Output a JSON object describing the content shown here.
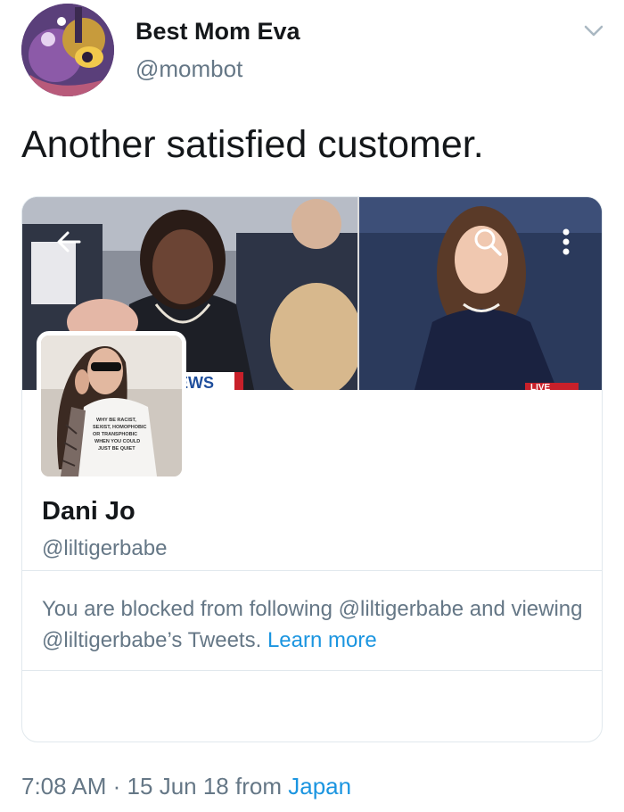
{
  "tweet": {
    "author_name": "Best Mom Eva",
    "author_handle": "@mombot",
    "text": "Another satisfied customer.",
    "time": "7:08 AM",
    "separator": "·",
    "date": "15 Jun 18",
    "from_label": "from",
    "location": "Japan"
  },
  "card": {
    "banner_news_text": "EWS",
    "banner_live_text": "LIVE",
    "shirt_text": "WHY BE RACIST, SEXIST, HOMOPHOBIC OR TRANSPHOBIC WHEN YOU COULD JUST BE QUIET",
    "profile_name": "Dani Jo",
    "profile_handle": "@liltigerbabe",
    "blocked_message": "You are blocked from following @liltigerbabe and viewing @liltigerbabe’s Tweets.",
    "learn_more": "Learn more"
  },
  "icons": {
    "menu": "chevron-down-icon",
    "back": "arrow-left-icon",
    "search": "search-icon",
    "more": "more-vertical-icon"
  },
  "colors": {
    "link": "#1b95e0",
    "secondary_text": "#657786",
    "primary_text": "#14171a",
    "divider": "#e1e8ed"
  }
}
